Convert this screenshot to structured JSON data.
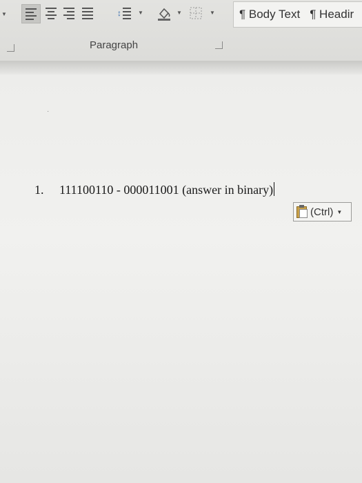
{
  "ribbon": {
    "group_label": "Paragraph",
    "styles": [
      "¶ Body Text",
      "¶ Headir"
    ]
  },
  "document": {
    "list_number": "1.",
    "text": "111100110 - 000011001 (answer in binary)"
  },
  "paste_options": {
    "label": "(Ctrl)"
  }
}
